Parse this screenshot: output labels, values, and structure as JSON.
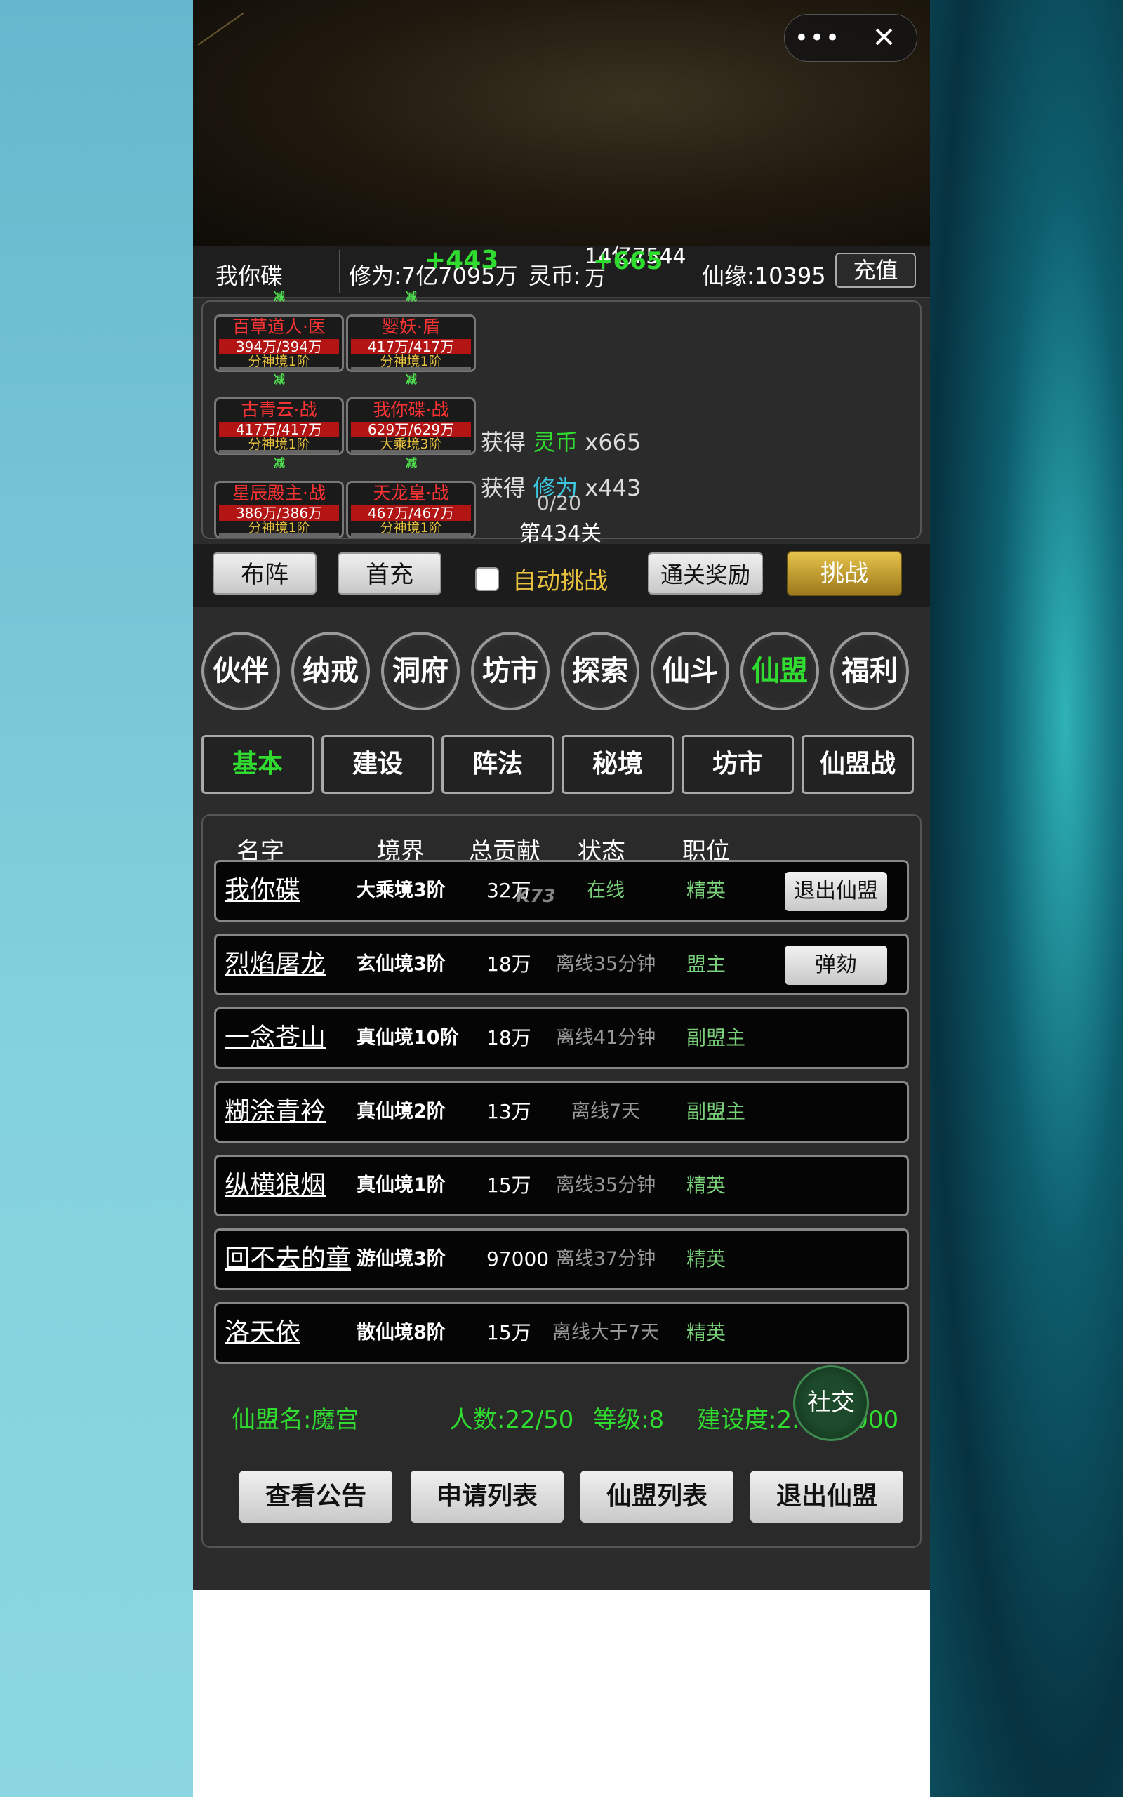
{
  "capsule": {
    "more": "•••",
    "close": "✕"
  },
  "player": {
    "name": "我你碟",
    "xiuwei_label": "修为:",
    "xiuwei_value": "7亿7095万",
    "lingbi_label": "灵币:",
    "lingbi_value": "14亿7544万",
    "xianyuan_label": "仙缘:",
    "xianyuan_value": "10395",
    "recharge": "充值",
    "gain_xiuwei": "+443",
    "gain_lingbi": "+665"
  },
  "heroes": [
    {
      "name": "百草道人·医",
      "hp": "394万/394万",
      "level": "分神境1阶"
    },
    {
      "name": "婴妖·盾",
      "hp": "417万/417万",
      "level": "分神境1阶"
    },
    {
      "name": "古青云·战",
      "hp": "417万/417万",
      "level": "分神境1阶"
    },
    {
      "name": "我你碟·战",
      "hp": "629万/629万",
      "level": "大乘境3阶"
    },
    {
      "name": "星辰殿主·战",
      "hp": "386万/386万",
      "level": "分神境1阶"
    },
    {
      "name": "天龙皇·战",
      "hp": "467万/467万",
      "level": "分神境1阶"
    }
  ],
  "arrow_text": "减",
  "battle_log": [
    {
      "prefix": "获得",
      "item": "灵币",
      "count": "x665"
    },
    {
      "prefix": "获得",
      "item": "修为",
      "count": "x443"
    }
  ],
  "stage": {
    "progress": "0/20",
    "name": "第434关"
  },
  "controls": {
    "formation": "布阵",
    "first_charge": "首充",
    "auto_label": "自动挑战",
    "clear_reward": "通关奖励",
    "challenge": "挑战"
  },
  "main_nav": [
    "伙伴",
    "纳戒",
    "洞府",
    "坊市",
    "探索",
    "仙斗",
    "仙盟",
    "福利"
  ],
  "main_nav_active": "仙盟",
  "sub_tabs": [
    "基本",
    "建设",
    "阵法",
    "秘境",
    "坊市",
    "仙盟战"
  ],
  "sub_tab_active": "基本",
  "table": {
    "headers": [
      "名字",
      "境界",
      "总贡献",
      "状态",
      "职位"
    ],
    "rows": [
      {
        "name": "我你碟",
        "realm": "大乘境3阶",
        "contribution": "32万",
        "status": "在线",
        "position": "精英",
        "action": "退出仙盟"
      },
      {
        "name": "烈焰屠龙",
        "realm": "玄仙境3阶",
        "contribution": "18万",
        "status": "离线35分钟",
        "position": "盟主",
        "action": "弹劾"
      },
      {
        "name": "一念苍山",
        "realm": "真仙境10阶",
        "contribution": "18万",
        "status": "离线41分钟",
        "position": "副盟主",
        "action": ""
      },
      {
        "name": "糊涂青衿",
        "realm": "真仙境2阶",
        "contribution": "13万",
        "status": "离线7天",
        "position": "副盟主",
        "action": ""
      },
      {
        "name": "纵横狼烟",
        "realm": "真仙境1阶",
        "contribution": "15万",
        "status": "离线35分钟",
        "position": "精英",
        "action": ""
      },
      {
        "name": "回不去的童",
        "realm": "游仙境3阶",
        "contribution": "97000",
        "status": "离线37分钟",
        "position": "精英",
        "action": ""
      },
      {
        "name": "洛天依",
        "realm": "散仙境8阶",
        "contribution": "15万",
        "status": "离线大于7天",
        "position": "精英",
        "action": ""
      }
    ]
  },
  "guild": {
    "name": "仙盟名:魔宫",
    "members": "人数:22/50",
    "level": "等级:8",
    "build": "建设度:2...1/3000"
  },
  "social": "社交",
  "bottom_buttons": [
    "查看公告",
    "申请列表",
    "仙盟列表",
    "退出仙盟"
  ],
  "watermark": "K73",
  "colors": {
    "accent_green": "#2fdc2f",
    "hero_red": "#ff3333",
    "gold": "#e8c23d"
  }
}
